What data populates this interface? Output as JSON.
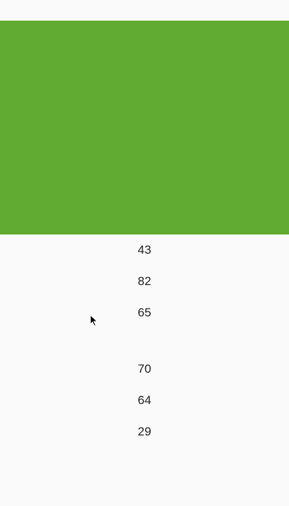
{
  "colors": {
    "banner": "#62ab32",
    "background": "#fafafa",
    "text": "#222222"
  },
  "list": {
    "group1": [
      "43",
      "82",
      "65"
    ],
    "group2": [
      "70",
      "64",
      "29"
    ]
  },
  "icons": {
    "cursor": "mouse-pointer-icon"
  }
}
